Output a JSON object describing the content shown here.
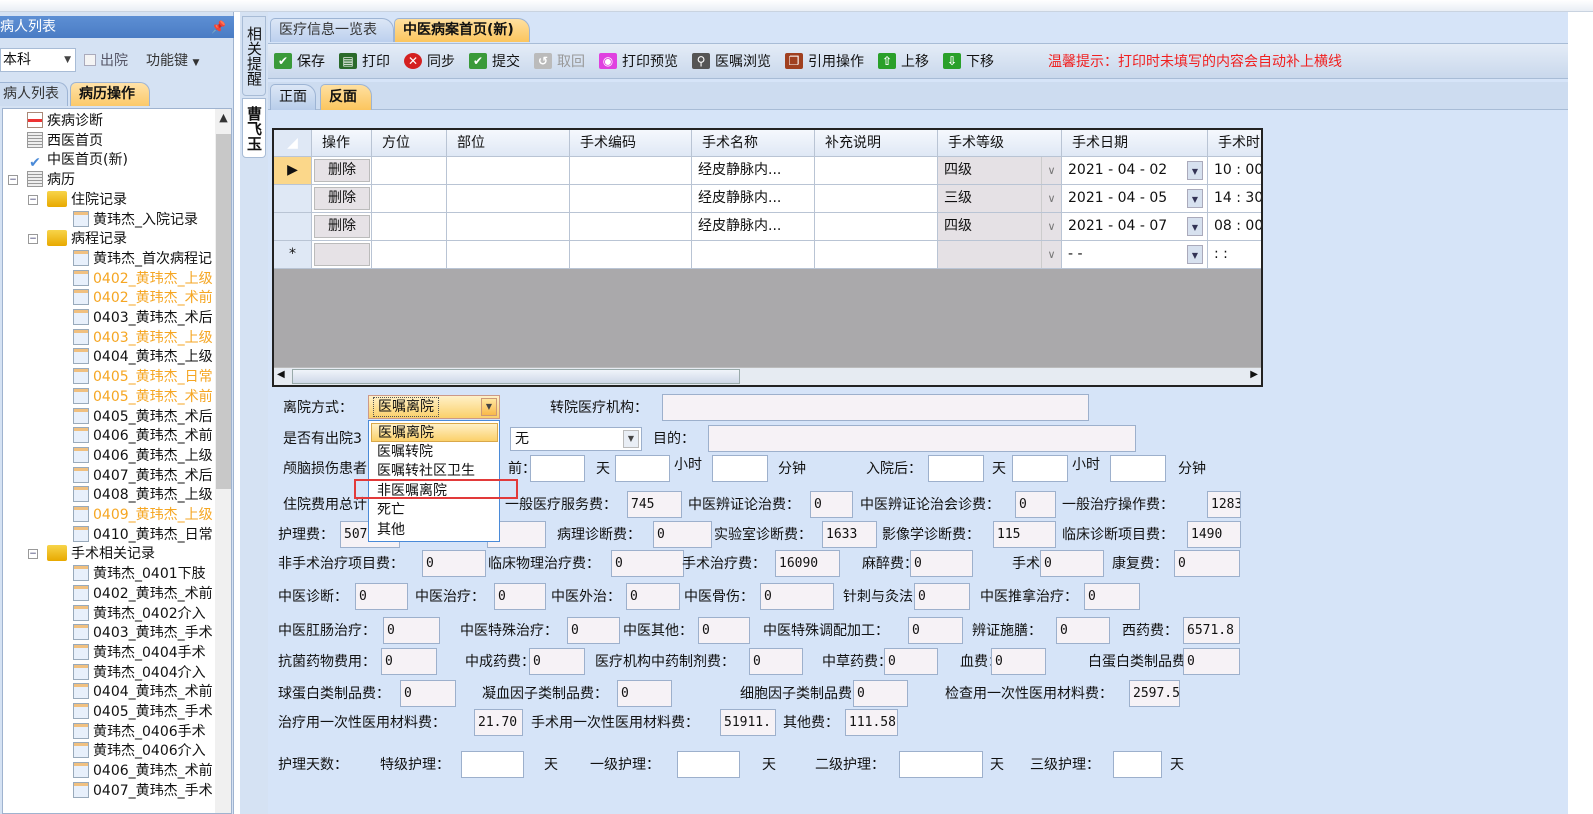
{
  "left_panel": {
    "title": "病人列表",
    "scope_combo": "本科",
    "discharged_label": "出院",
    "function_keys_label": "功能键",
    "tabs": [
      "病人列表",
      "病历操作"
    ],
    "tree": [
      {
        "text": "疾病诊断",
        "level": 0,
        "icon": "calendar-icon"
      },
      {
        "text": "西医首页",
        "level": 0,
        "icon": "page-icon"
      },
      {
        "text": "中医首页(新)",
        "level": 0,
        "icon": "check-icon"
      },
      {
        "text": "病历",
        "level": 0,
        "icon": "page-icon",
        "expanded": true
      },
      {
        "text": "住院记录",
        "level": 1,
        "icon": "folder-icon",
        "expanded": true
      },
      {
        "text": "黄玮杰_入院记录",
        "level": 2,
        "icon": "document-icon"
      },
      {
        "text": "病程记录",
        "level": 1,
        "icon": "folder-icon",
        "expanded": true
      },
      {
        "text": "黄玮杰_首次病程记",
        "level": 2,
        "icon": "document-icon"
      },
      {
        "text": "0402_黄玮杰_上级",
        "level": 2,
        "icon": "document-icon",
        "highlight": true
      },
      {
        "text": "0402_黄玮杰_术前",
        "level": 2,
        "icon": "document-icon",
        "highlight": true
      },
      {
        "text": "0403_黄玮杰_术后",
        "level": 2,
        "icon": "document-icon"
      },
      {
        "text": "0403_黄玮杰_上级",
        "level": 2,
        "icon": "document-icon",
        "highlight": true
      },
      {
        "text": "0404_黄玮杰_上级",
        "level": 2,
        "icon": "document-icon"
      },
      {
        "text": "0405_黄玮杰_日常",
        "level": 2,
        "icon": "document-icon",
        "highlight": true
      },
      {
        "text": "0405_黄玮杰_术前",
        "level": 2,
        "icon": "document-icon",
        "highlight": true
      },
      {
        "text": "0405_黄玮杰_术后",
        "level": 2,
        "icon": "document-icon"
      },
      {
        "text": "0406_黄玮杰_术前",
        "level": 2,
        "icon": "document-icon"
      },
      {
        "text": "0406_黄玮杰_上级",
        "level": 2,
        "icon": "document-icon"
      },
      {
        "text": "0407_黄玮杰_术后",
        "level": 2,
        "icon": "document-icon"
      },
      {
        "text": "0408_黄玮杰_上级",
        "level": 2,
        "icon": "document-icon"
      },
      {
        "text": "0409_黄玮杰_上级",
        "level": 2,
        "icon": "document-icon",
        "highlight": true
      },
      {
        "text": "0410_黄玮杰_日常",
        "level": 2,
        "icon": "document-icon"
      },
      {
        "text": "手术相关记录",
        "level": 1,
        "icon": "folder-icon",
        "expanded": true
      },
      {
        "text": "黄玮杰_0401下肢",
        "level": 2,
        "icon": "document-icon"
      },
      {
        "text": "0402_黄玮杰_术前",
        "level": 2,
        "icon": "document-icon"
      },
      {
        "text": "黄玮杰_0402介入",
        "level": 2,
        "icon": "document-icon"
      },
      {
        "text": "0403_黄玮杰_手术",
        "level": 2,
        "icon": "document-icon"
      },
      {
        "text": "黄玮杰_0404手术",
        "level": 2,
        "icon": "document-icon"
      },
      {
        "text": "黄玮杰_0404介入",
        "level": 2,
        "icon": "document-icon"
      },
      {
        "text": "0404_黄玮杰_术前",
        "level": 2,
        "icon": "document-icon"
      },
      {
        "text": "0405_黄玮杰_手术",
        "level": 2,
        "icon": "document-icon"
      },
      {
        "text": "黄玮杰_0406手术",
        "level": 2,
        "icon": "document-icon"
      },
      {
        "text": "黄玮杰_0406介入",
        "level": 2,
        "icon": "document-icon"
      },
      {
        "text": "0406_黄玮杰_术前",
        "level": 2,
        "icon": "document-icon"
      },
      {
        "text": "0407_黄玮杰_手术",
        "level": 2,
        "icon": "document-icon"
      }
    ],
    "highlight_color": "#f5a623"
  },
  "side_tabs": {
    "reminder": "相关提醒",
    "patient": "曹飞玉"
  },
  "main": {
    "tabs": [
      "医疗信息一览表",
      "中医病案首页(新)"
    ],
    "active_tab": 1,
    "toolbar": [
      {
        "label": "保存",
        "icon": "save-check-icon",
        "color": "#3a9a3a"
      },
      {
        "label": "打印",
        "icon": "printer-icon",
        "color": "#2a6a2a"
      },
      {
        "label": "同步",
        "icon": "sync-x-icon",
        "color": "#d42020"
      },
      {
        "label": "提交",
        "icon": "submit-check-icon",
        "color": "#3a9a3a"
      },
      {
        "label": "取回",
        "icon": "retrieve-icon",
        "color": "#bbbbbb",
        "disabled": true
      },
      {
        "label": "打印预览",
        "icon": "print-preview-icon",
        "color": "#e040e0"
      },
      {
        "label": "医嘱浏览",
        "icon": "magnifier-icon",
        "color": "#555555"
      },
      {
        "label": "引用操作",
        "icon": "reference-icon",
        "color": "#a04020"
      },
      {
        "label": "上移",
        "icon": "arrow-up-icon",
        "color": "#2aa02a"
      },
      {
        "label": "下移",
        "icon": "arrow-down-icon",
        "color": "#2aa02a"
      }
    ],
    "tip": "温馨提示：打印时未填写的内容会自动补上横线",
    "sub_tabs": [
      "正面",
      "反面"
    ],
    "active_sub_tab": 1
  },
  "grid": {
    "columns": [
      "操作",
      "方位",
      "部位",
      "手术编码",
      "手术名称",
      "补充说明",
      "手术等级",
      "手术日期",
      "手术时"
    ],
    "delete_label": "删除",
    "new_row_marker": "*",
    "current_row_marker": "▶",
    "rows": [
      {
        "name": "经皮静脉内...",
        "level": "四级",
        "date": "2021 - 04 - 02",
        "time": "10 : 00"
      },
      {
        "name": "经皮静脉内...",
        "level": "三级",
        "date": "2021 - 04 - 05",
        "time": "14 : 30"
      },
      {
        "name": "经皮静脉内...",
        "level": "四级",
        "date": "2021 - 04 - 07",
        "time": "08 : 00"
      }
    ],
    "new_row": {
      "date": "  -   -",
      "time": " :  :"
    }
  },
  "form": {
    "leave_label": "离院方式：",
    "leave_value": "医嘱离院",
    "leave_options": [
      "医嘱离院",
      "医嘱转院",
      "医嘱转社区卫生",
      "非医嘱离院",
      "死亡",
      "其他"
    ],
    "leave_highlighted": "非医嘱离院",
    "readmit_combo": "无",
    "rows": [
      [
        {
          "label": "转院医疗机构："
        },
        {
          "value": ""
        }
      ],
      [
        {
          "label": "是否有出院3"
        },
        {
          "label": "目的："
        },
        {
          "value": ""
        }
      ],
      [
        {
          "label": "颅脑损伤患者"
        },
        {
          "label": "前："
        },
        {
          "value": ""
        },
        {
          "label": "天"
        },
        {
          "value": ""
        },
        {
          "label": "小时"
        },
        {
          "value": ""
        },
        {
          "label": "分钟"
        },
        {
          "label": "入院后："
        },
        {
          "value": ""
        },
        {
          "label": "天"
        },
        {
          "value": ""
        },
        {
          "label": "小时"
        },
        {
          "value": ""
        },
        {
          "label": "分钟"
        }
      ],
      [
        {
          "label": "住院费用总计"
        },
        {
          "label": "一般医疗服务费："
        },
        {
          "value": "745"
        },
        {
          "label": "中医辨证论治费："
        },
        {
          "value": "0"
        },
        {
          "label": "中医辨证论治会诊费："
        },
        {
          "value": "0"
        },
        {
          "label": "一般治疗操作费："
        },
        {
          "value": "1283"
        }
      ],
      [
        {
          "label": "护理费："
        },
        {
          "value": "507"
        },
        {
          "value": ""
        },
        {
          "label": "病理诊断费："
        },
        {
          "value": "0"
        },
        {
          "label": "实验室诊断费："
        },
        {
          "value": "1633"
        },
        {
          "label": "影像学诊断费："
        },
        {
          "value": "115"
        },
        {
          "label": "临床诊断项目费："
        },
        {
          "value": "1490"
        }
      ],
      [
        {
          "label": "非手术治疗项目费："
        },
        {
          "value": "0"
        },
        {
          "label": "临床物理治疗费："
        },
        {
          "value": "0"
        },
        {
          "label": "手术治疗费："
        },
        {
          "value": "16090"
        },
        {
          "label": "麻醉费："
        },
        {
          "value": "0"
        },
        {
          "label": "手术费："
        },
        {
          "value": "0"
        },
        {
          "label": "康复费："
        },
        {
          "value": "0"
        }
      ],
      [
        {
          "label": "中医诊断："
        },
        {
          "value": "0"
        },
        {
          "label": "中医治疗："
        },
        {
          "value": "0"
        },
        {
          "label": "中医外治："
        },
        {
          "value": "0"
        },
        {
          "label": "中医骨伤："
        },
        {
          "value": "0"
        },
        {
          "label": "针刺与灸法："
        },
        {
          "value": "0"
        },
        {
          "label": "中医推拿治疗："
        },
        {
          "value": "0"
        }
      ],
      [
        {
          "label": "中医肛肠治疗："
        },
        {
          "value": "0"
        },
        {
          "label": "中医特殊治疗："
        },
        {
          "value": "0"
        },
        {
          "label": "中医其他："
        },
        {
          "value": "0"
        },
        {
          "label": "中医特殊调配加工："
        },
        {
          "value": "0"
        },
        {
          "label": "辨证施膳："
        },
        {
          "value": "0"
        },
        {
          "label": "西药费："
        },
        {
          "value": "6571.8"
        }
      ],
      [
        {
          "label": "抗菌药物费用："
        },
        {
          "value": "0"
        },
        {
          "label": "中成药费："
        },
        {
          "value": "0"
        },
        {
          "label": "医疗机构中药制剂费："
        },
        {
          "value": "0"
        },
        {
          "label": "中草药费："
        },
        {
          "value": "0"
        },
        {
          "label": "血费："
        },
        {
          "value": "0"
        },
        {
          "label": "白蛋白类制品费："
        },
        {
          "value": "0"
        }
      ],
      [
        {
          "label": "球蛋白类制品费："
        },
        {
          "value": "0"
        },
        {
          "label": "凝血因子类制品费："
        },
        {
          "value": "0"
        },
        {
          "label": "细胞因子类制品费："
        },
        {
          "value": "0"
        },
        {
          "label": "检查用一次性医用材料费："
        },
        {
          "value": "2597.5"
        }
      ],
      [
        {
          "label": "治疗用一次性医用材料费："
        },
        {
          "value": "21.70"
        },
        {
          "label": "手术用一次性医用材料费："
        },
        {
          "value": "51911."
        },
        {
          "label": "其他费："
        },
        {
          "value": "111.58"
        }
      ],
      [
        {
          "label": "护理天数："
        },
        {
          "label": "特级护理："
        },
        {
          "value": ""
        },
        {
          "label": "天"
        },
        {
          "label": "一级护理："
        },
        {
          "value": ""
        },
        {
          "label": "天"
        },
        {
          "label": "二级护理："
        },
        {
          "value": ""
        },
        {
          "label": "天"
        },
        {
          "label": "三级护理："
        },
        {
          "value": ""
        },
        {
          "label": "天"
        }
      ]
    ]
  }
}
